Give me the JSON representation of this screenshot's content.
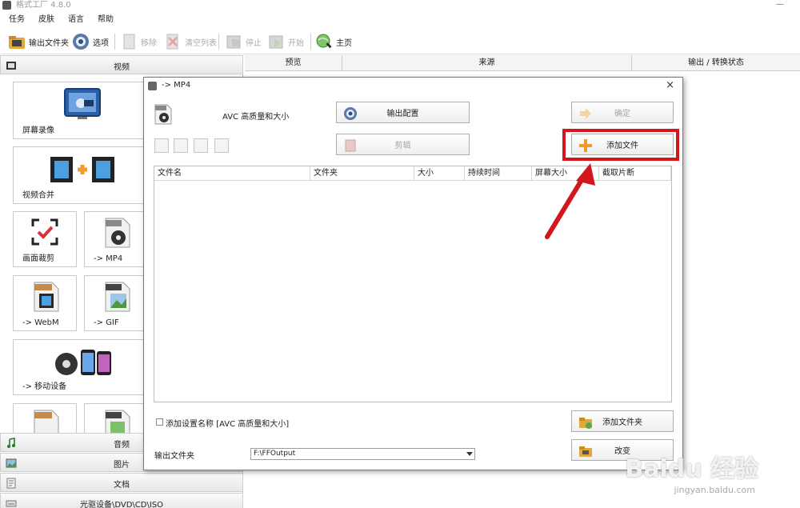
{
  "app": {
    "title": "格式工厂 4.8.0",
    "minimize": "—"
  },
  "menu": [
    "任务",
    "皮肤",
    "语言",
    "帮助"
  ],
  "toolbar": {
    "output_folder": "输出文件夹",
    "options": "选项",
    "remove": "移除",
    "clear_list": "清空列表",
    "stop": "停止",
    "start": "开始",
    "home": "主页"
  },
  "left": {
    "video_header": "视频",
    "tiles": {
      "screen_record": "屏幕录像",
      "video_merge": "视频合并",
      "crop": "画面裁剪",
      "to_mp4": "-> MP4",
      "to_webm": "-> WebM",
      "to_gif": "-> GIF",
      "to_mobile": "-> 移动设备"
    },
    "audio_header": "音频",
    "image_header": "图片",
    "doc_header": "文档",
    "disc_header": "光驱设备\\DVD\\CD\\ISO"
  },
  "columns": {
    "preview": "预览",
    "source": "来源",
    "output_status": "输出 / 转换状态"
  },
  "dialog": {
    "title": "-> MP4",
    "close": "×",
    "profile": "AVC 高质量和大小",
    "output_config": "输出配置",
    "ok": "确定",
    "clip": "剪辑",
    "add_file": "添加文件",
    "add_folder": "添加文件夹",
    "change": "改变",
    "columns": [
      "文件名",
      "文件夹",
      "大小",
      "持续时间",
      "屏幕大小",
      "截取片断"
    ],
    "add_setting_label": "添加设置名称 [AVC 高质量和大小]",
    "output_folder_label": "输出文件夹",
    "output_folder_value": "F:\\FFOutput"
  },
  "watermark": {
    "brand": "Baidu 经验",
    "url": "jingyan.baidu.com"
  },
  "colors": {
    "highlight": "#d2161c",
    "arrow": "#d2161c",
    "accent_orange": "#f29a2e"
  }
}
